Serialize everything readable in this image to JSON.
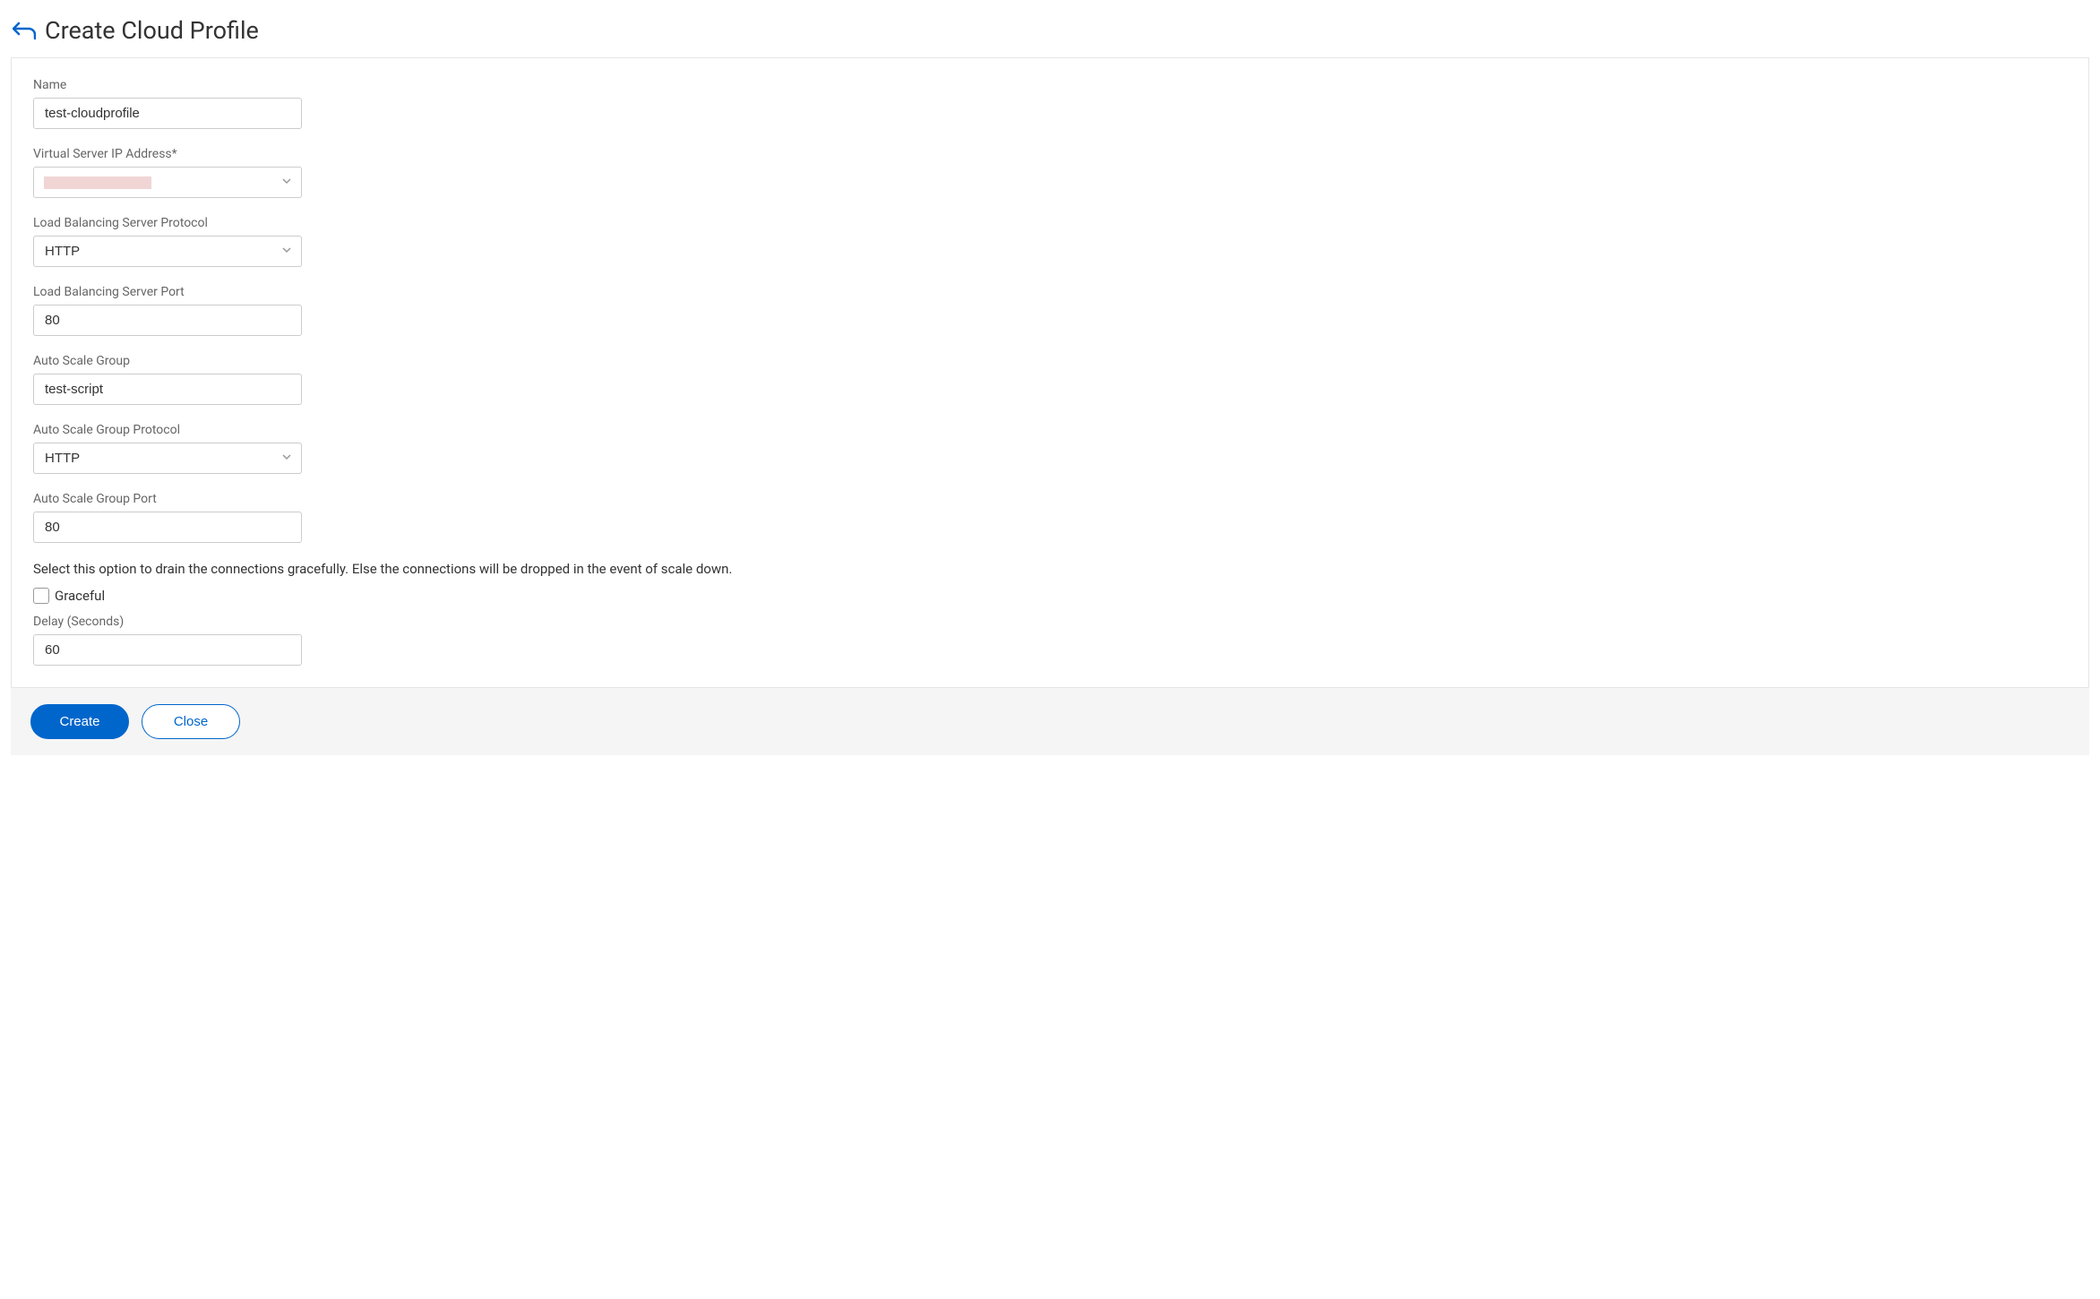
{
  "header": {
    "title": "Create Cloud Profile"
  },
  "form": {
    "name": {
      "label": "Name",
      "value": "test-cloudprofile"
    },
    "virtual_server_ip": {
      "label": "Virtual Server IP Address*",
      "value": ""
    },
    "lb_protocol": {
      "label": "Load Balancing Server Protocol",
      "value": "HTTP"
    },
    "lb_port": {
      "label": "Load Balancing Server Port",
      "value": "80"
    },
    "asg": {
      "label": "Auto Scale Group",
      "value": "test-script"
    },
    "asg_protocol": {
      "label": "Auto Scale Group Protocol",
      "value": "HTTP"
    },
    "asg_port": {
      "label": "Auto Scale Group Port",
      "value": "80"
    },
    "graceful_help": "Select this option to drain the connections gracefully. Else the connections will be dropped in the event of scale down.",
    "graceful": {
      "label": "Graceful",
      "checked": false
    },
    "delay": {
      "label": "Delay (Seconds)",
      "value": "60"
    }
  },
  "buttons": {
    "create": "Create",
    "close": "Close"
  }
}
